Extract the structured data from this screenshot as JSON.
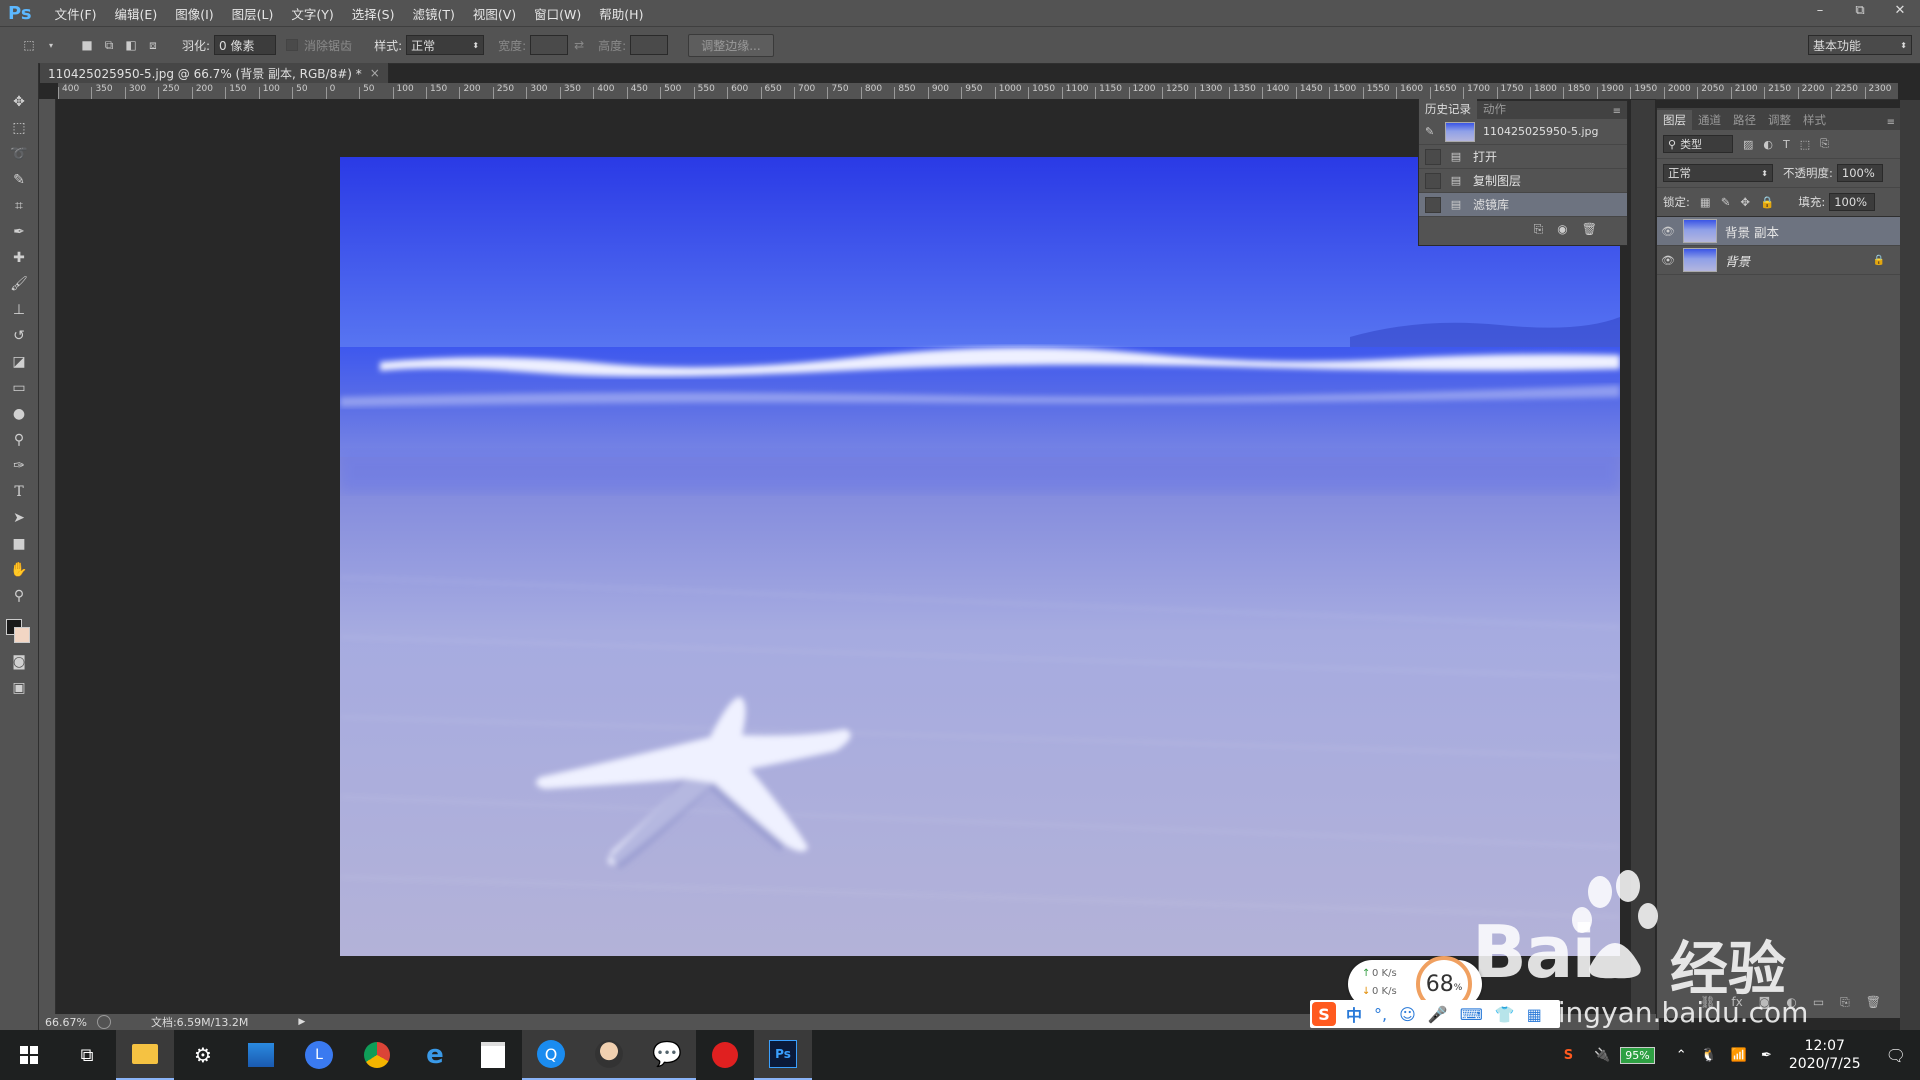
{
  "menubar": {
    "logo": "Ps",
    "items": [
      "文件(F)",
      "编辑(E)",
      "图像(I)",
      "图层(L)",
      "文字(Y)",
      "选择(S)",
      "滤镜(T)",
      "视图(V)",
      "窗口(W)",
      "帮助(H)"
    ],
    "window_controls": [
      "–",
      "⧉",
      "✕"
    ]
  },
  "options": {
    "feather_label": "羽化:",
    "feather_value": "0 像素",
    "antialias_label": "消除锯齿",
    "style_label": "样式:",
    "style_value": "正常",
    "width_label": "宽度:",
    "height_label": "高度:",
    "refine_edge": "调整边缘...",
    "workspace": "基本功能"
  },
  "document": {
    "tab_title": "110425025950-5.jpg @ 66.7% (背景 副本, RGB/8#) *",
    "tab_close": "×",
    "zoom": "66.67%",
    "doc_info": "文档:6.59M/13.2M"
  },
  "ruler_h": [
    "400",
    "350",
    "300",
    "250",
    "200",
    "150",
    "100",
    "50",
    "0",
    "50",
    "100",
    "150",
    "200",
    "250",
    "300",
    "350",
    "400",
    "450",
    "500",
    "550",
    "600",
    "650",
    "700",
    "750",
    "800",
    "850",
    "900",
    "950",
    "1000",
    "1050",
    "1100",
    "1150",
    "1200",
    "1250",
    "1300",
    "1350",
    "1400",
    "1450",
    "1500",
    "1550",
    "1600",
    "1650",
    "1700",
    "1750",
    "1800",
    "1850",
    "1900",
    "1950",
    "2000",
    "2050",
    "2100",
    "2150",
    "2200",
    "2250",
    "2300"
  ],
  "history": {
    "tabs": [
      "历史记录",
      "动作"
    ],
    "snapshot": "110425025950-5.jpg",
    "steps": [
      "打开",
      "复制图层",
      "滤镜库"
    ]
  },
  "layers": {
    "tabs": [
      "图层",
      "通道",
      "路径",
      "调整",
      "样式"
    ],
    "filter_kind": "类型",
    "blend_mode": "正常",
    "opacity_label": "不透明度:",
    "opacity_value": "100%",
    "lock_label": "锁定:",
    "fill_label": "填充:",
    "fill_value": "100%",
    "items": [
      {
        "name": "背景 副本",
        "selected": true
      },
      {
        "name": "背景",
        "locked": true
      }
    ]
  },
  "taskbar": {
    "battery": "95%",
    "time": "12:07",
    "date": "2020/7/25"
  },
  "widgets": {
    "speed_up": "0  K/s",
    "speed_down": "0  K/s",
    "cpu": "68",
    "cpu_unit": "%",
    "ime_lang": "中",
    "watermark_brand": "Bai",
    "watermark_brand2": "经验",
    "watermark_url": "jingyan.baidu.com"
  }
}
